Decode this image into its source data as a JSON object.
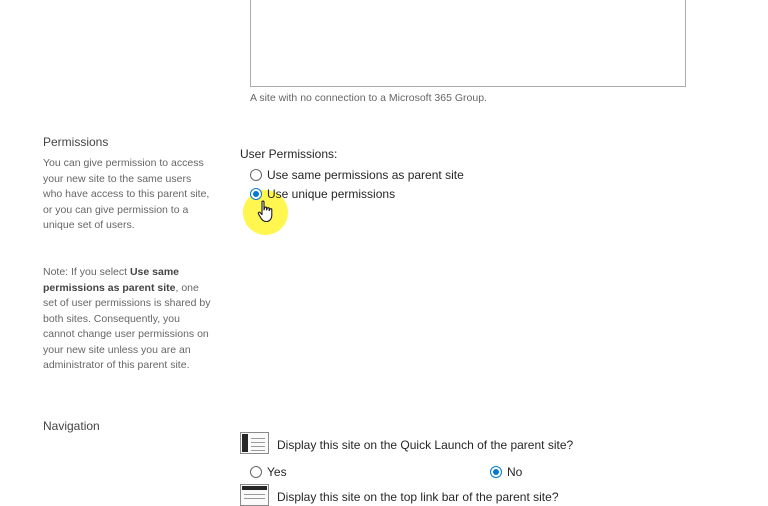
{
  "description_area": {
    "caption": "A site with no connection to a Microsoft 365 Group."
  },
  "permissions": {
    "title": "Permissions",
    "description": "You can give permission to access your new site to the same users who have access to this parent site, or you can give permission to a unique set of users.",
    "note_prefix": "Note: If you select ",
    "note_bold": "Use same permissions as parent site",
    "note_suffix": ", one set of user permissions is shared by both sites. Consequently, you cannot change user permissions on your new site unless you are an administrator of this parent site.",
    "field_label": "User Permissions:",
    "options": [
      {
        "label": "Use same permissions as parent site",
        "checked": false
      },
      {
        "label": "Use unique permissions",
        "checked": true
      }
    ]
  },
  "navigation": {
    "title": "Navigation",
    "quick_launch_question": "Display this site on the Quick Launch of the parent site?",
    "quick_launch_yes": "Yes",
    "quick_launch_no": "No",
    "quick_launch_selected": "No",
    "top_link_question": "Display this site on the top link bar of the parent site?"
  },
  "colors": {
    "radio_accent": "#0078d4",
    "cursor_highlight": "#fff528"
  },
  "icons": {
    "cursor": "hand-pointer-icon",
    "quick_launch": "quick-launch-icon",
    "top_link_bar": "top-link-bar-icon"
  }
}
